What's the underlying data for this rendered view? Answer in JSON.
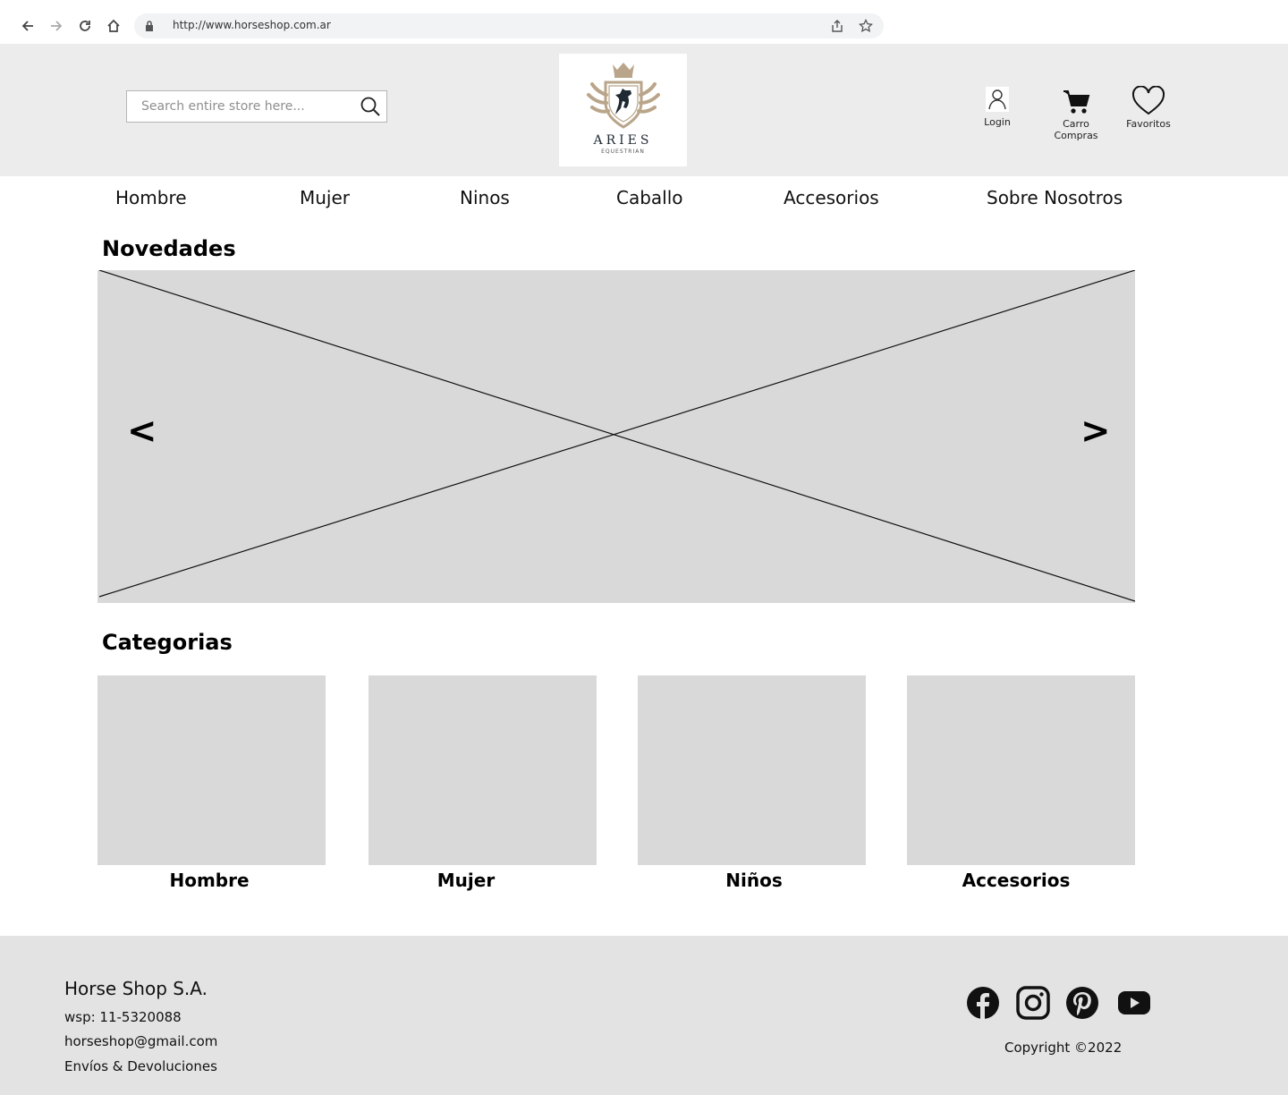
{
  "browser": {
    "url": "http://www.horseshop.com.ar"
  },
  "header": {
    "search_placeholder": "Search entire store here...",
    "logo": {
      "name": "ARIES",
      "tagline": "EQUESTRIAN"
    },
    "actions": [
      {
        "label": "Login",
        "icon": "user-icon"
      },
      {
        "label": "Carro Compras",
        "icon": "cart-icon"
      },
      {
        "label": "Favoritos",
        "icon": "heart-icon"
      }
    ]
  },
  "nav": {
    "items": [
      "Hombre",
      "Mujer",
      "Ninos",
      "Caballo",
      "Accesorios",
      "Sobre Nosotros"
    ]
  },
  "novedades": {
    "title": "Novedades",
    "prev": "<",
    "next": ">"
  },
  "categorias": {
    "title": "Categorias",
    "items": [
      "Hombre",
      "Mujer",
      "Niños",
      "Accesorios"
    ]
  },
  "footer": {
    "company": "Horse Shop S.A.",
    "phone": "wsp: 11-5320088",
    "email": "horseshop@gmail.com",
    "returns": "Envíos & Devoluciones",
    "copyright": "Copyright ©2022",
    "social": [
      "facebook-icon",
      "instagram-icon",
      "pinterest-icon",
      "youtube-icon"
    ]
  },
  "colors": {
    "header_bg": "#ececec",
    "placeholder_bg": "#d9d9d9",
    "footer_bg": "#e3e3e3",
    "logo_gold": "#b9a58a",
    "logo_dark": "#1f2a33"
  }
}
